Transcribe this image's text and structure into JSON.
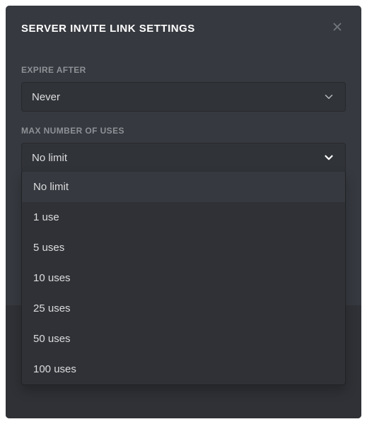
{
  "modal": {
    "title": "SERVER INVITE LINK SETTINGS"
  },
  "expire": {
    "label": "EXPIRE AFTER",
    "value": "Never"
  },
  "max_uses": {
    "label": "MAX NUMBER OF USES",
    "value": "No limit",
    "options": [
      "No limit",
      "1 use",
      "5 uses",
      "10 uses",
      "25 uses",
      "50 uses",
      "100 uses"
    ]
  }
}
